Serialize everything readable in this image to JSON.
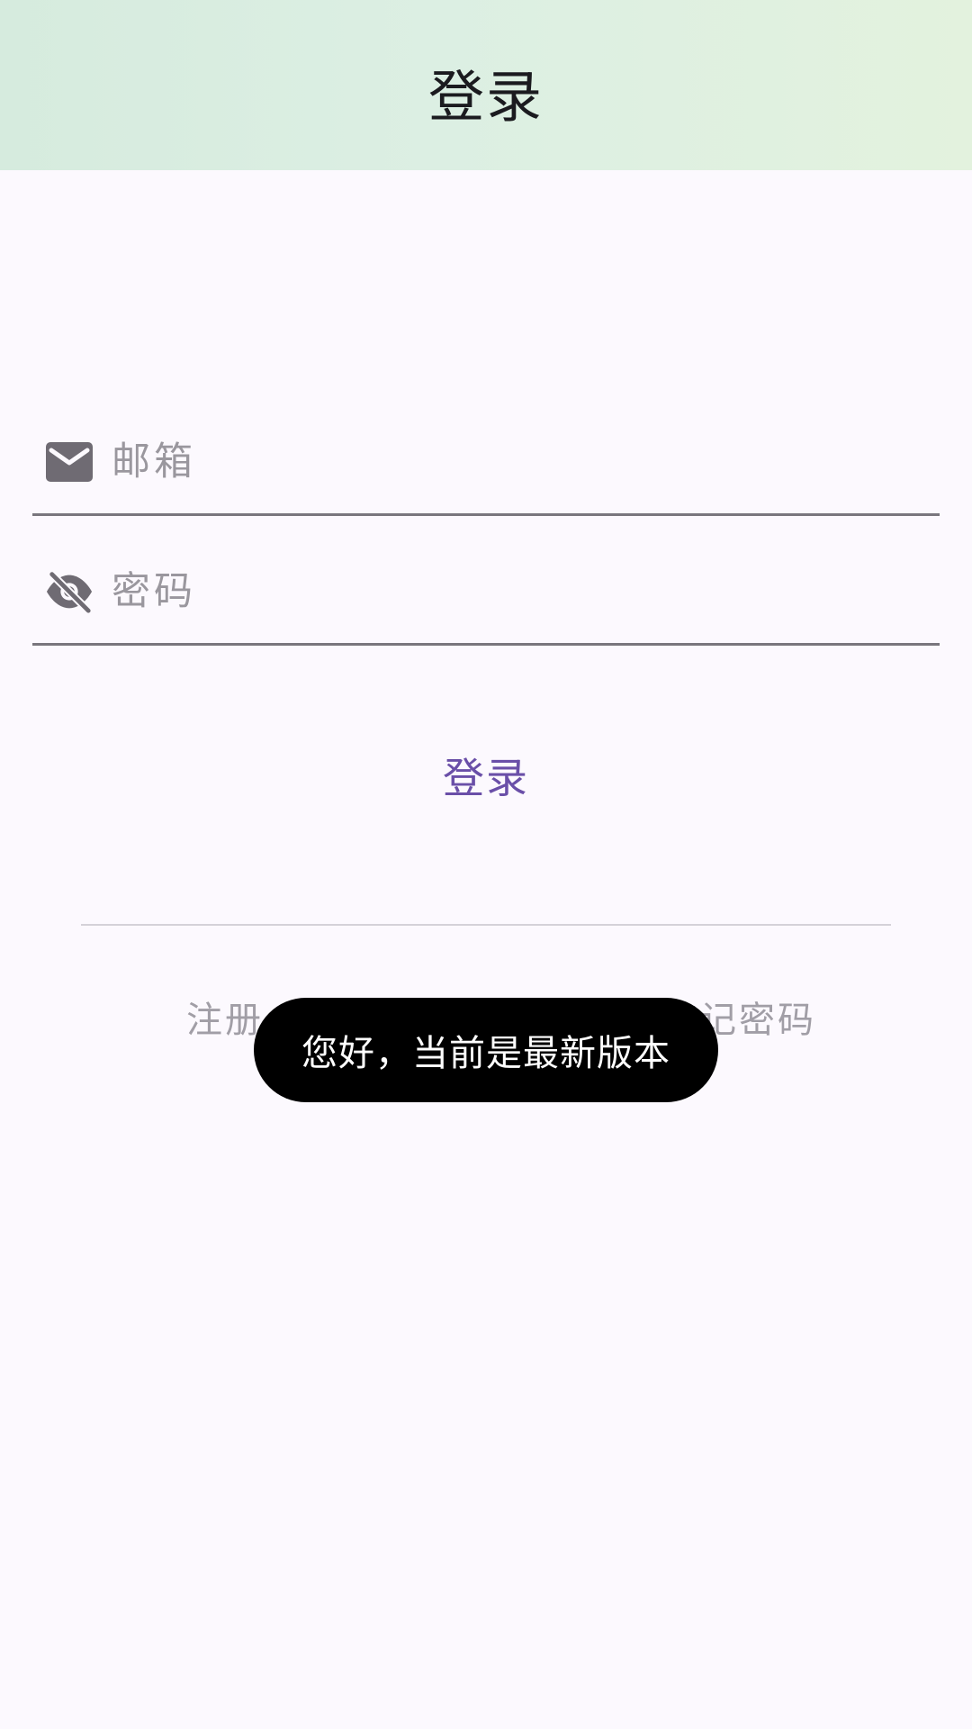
{
  "app_bar": {
    "title": "登录"
  },
  "form": {
    "email": {
      "icon": "mail-icon",
      "placeholder": "邮箱",
      "value": ""
    },
    "password": {
      "icon": "visibility-off-icon",
      "placeholder": "密码",
      "value": ""
    },
    "login_label": "登录"
  },
  "links": {
    "register": "注册",
    "forgot_password": "忘记密码"
  },
  "toast": {
    "message": "您好，当前是最新版本"
  },
  "colors": {
    "accent": "#6a4fa8",
    "icon": "#6f6b73",
    "toast_bg": "#000000"
  }
}
